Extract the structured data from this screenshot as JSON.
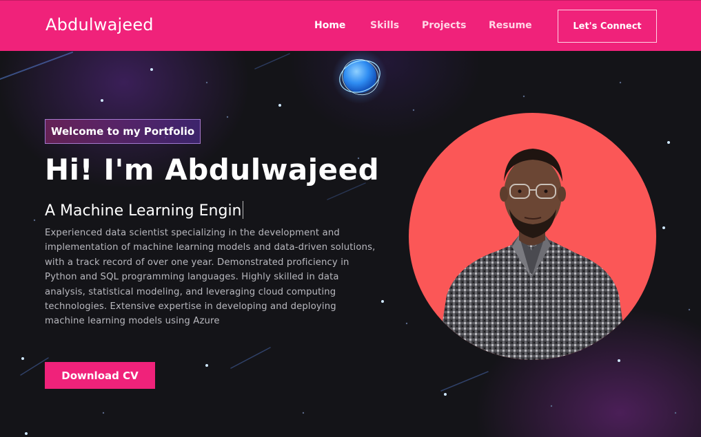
{
  "navbar": {
    "logo": "Abdulwajeed",
    "links": [
      {
        "label": "Home",
        "active": true
      },
      {
        "label": "Skills",
        "active": false
      },
      {
        "label": "Projects",
        "active": false
      },
      {
        "label": "Resume",
        "active": false
      }
    ],
    "connect_label": "Let's Connect"
  },
  "hero": {
    "badge": "Welcome to my Portfolio",
    "title": "Hi! I'm Abdulwajeed",
    "subtitle_typed": "A Machine Learning Engin",
    "description": "Experienced data scientist specializing in the development and implementation of machine learning models and data-driven solutions, with a track record of over one year. Demonstrated proficiency in Python and SQL programming languages. Highly skilled in data analysis, statistical modeling, and leveraging cloud computing technologies. Extensive expertise in developing and deploying machine learning models using Azure",
    "download_label": "Download CV"
  },
  "profile": {
    "circle_color": "#fb5757"
  },
  "colors": {
    "accent": "#f0227a",
    "background": "#141418"
  },
  "icons": {
    "globe": "glowing-globe-icon"
  }
}
